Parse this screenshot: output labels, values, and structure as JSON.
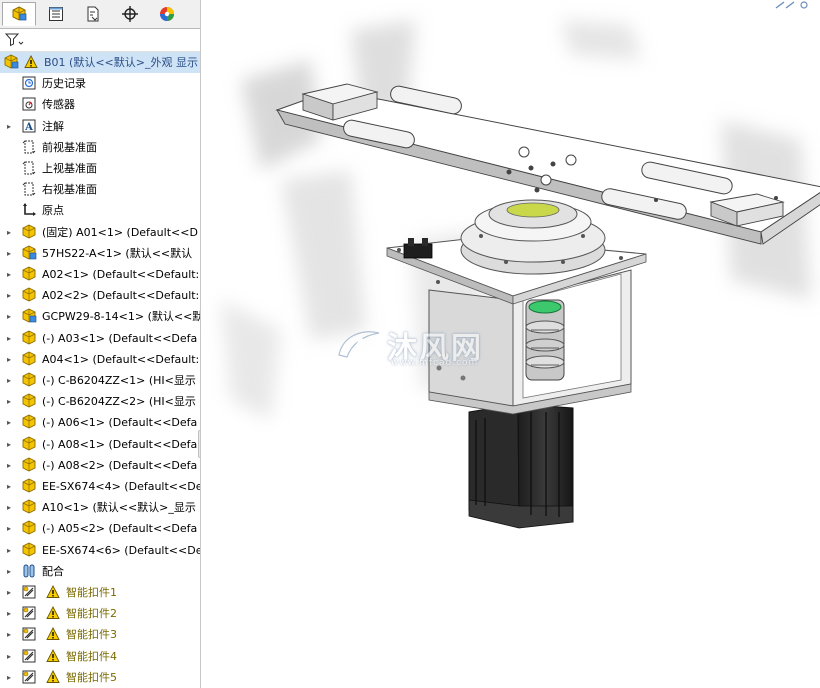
{
  "tabs": [
    {
      "name": "feature-manager",
      "icon": "assembly-icon"
    },
    {
      "name": "property-manager",
      "icon": "list-icon"
    },
    {
      "name": "configuration-manager",
      "icon": "config-icon"
    },
    {
      "name": "dim-xpert-manager",
      "icon": "crosshair-icon"
    },
    {
      "name": "display-manager",
      "icon": "color-wheel-icon"
    }
  ],
  "tree": {
    "root": "B01 (默认<<默认>_外观 显示",
    "items": [
      {
        "label": "历史记录",
        "icon": "history-icon",
        "expandable": false
      },
      {
        "label": "传感器",
        "icon": "sensor-icon",
        "expandable": false
      },
      {
        "label": "注解",
        "icon": "annotation-icon",
        "expandable": true
      },
      {
        "label": "前视基准面",
        "icon": "plane-icon",
        "expandable": false
      },
      {
        "label": "上视基准面",
        "icon": "plane-icon",
        "expandable": false
      },
      {
        "label": "右视基准面",
        "icon": "plane-icon",
        "expandable": false
      },
      {
        "label": "原点",
        "icon": "origin-icon",
        "expandable": false
      },
      {
        "label": "(固定) A01<1> (Default<<D",
        "icon": "part-icon",
        "expandable": true
      },
      {
        "label": "57HS22-A<1> (默认<<默认",
        "icon": "subassembly-icon",
        "expandable": true
      },
      {
        "label": "A02<1> (Default<<Default:",
        "icon": "part-icon",
        "expandable": true
      },
      {
        "label": "A02<2> (Default<<Default:",
        "icon": "part-icon",
        "expandable": true
      },
      {
        "label": "GCPW29-8-14<1> (默认<<默",
        "icon": "subassembly-icon",
        "expandable": true
      },
      {
        "label": "(-) A03<1> (Default<<Defa",
        "icon": "part-icon",
        "expandable": true
      },
      {
        "label": "A04<1> (Default<<Default:",
        "icon": "part-icon",
        "expandable": true
      },
      {
        "label": "(-) C-B6204ZZ<1> (HI<显示",
        "icon": "part-icon",
        "expandable": true
      },
      {
        "label": "(-) C-B6204ZZ<2> (HI<显示",
        "icon": "part-icon",
        "expandable": true
      },
      {
        "label": "(-) A06<1> (Default<<Defa",
        "icon": "part-icon",
        "expandable": true
      },
      {
        "label": "(-) A08<1> (Default<<Defa",
        "icon": "part-icon",
        "expandable": true
      },
      {
        "label": "(-) A08<2> (Default<<Defa",
        "icon": "part-icon",
        "expandable": true
      },
      {
        "label": "EE-SX674<4> (Default<<De",
        "icon": "part-icon",
        "expandable": true
      },
      {
        "label": "A10<1> (默认<<默认>_显示",
        "icon": "part-icon",
        "expandable": true
      },
      {
        "label": "(-) A05<2> (Default<<Defa",
        "icon": "part-icon",
        "expandable": true
      },
      {
        "label": "EE-SX674<6> (Default<<De",
        "icon": "part-icon",
        "expandable": true
      },
      {
        "label": "配合",
        "icon": "mates-icon",
        "expandable": true
      },
      {
        "label": "智能扣件1",
        "icon": "smart-fastener-icon",
        "expandable": true,
        "warning": true
      },
      {
        "label": "智能扣件2",
        "icon": "smart-fastener-icon",
        "expandable": true,
        "warning": true
      },
      {
        "label": "智能扣件3",
        "icon": "smart-fastener-icon",
        "expandable": true,
        "warning": true
      },
      {
        "label": "智能扣件4",
        "icon": "smart-fastener-icon",
        "expandable": true,
        "warning": true
      },
      {
        "label": "智能扣件5",
        "icon": "smart-fastener-icon",
        "expandable": true,
        "warning": true
      }
    ]
  },
  "watermark": {
    "text": "沐风网",
    "url": "www.mfcad.com"
  },
  "colors": {
    "selection": "#cfe3f7",
    "part": "#f2c200",
    "warning": "#f0c000",
    "motor": "#2b2b2b",
    "plate": "#e6e6e6"
  }
}
